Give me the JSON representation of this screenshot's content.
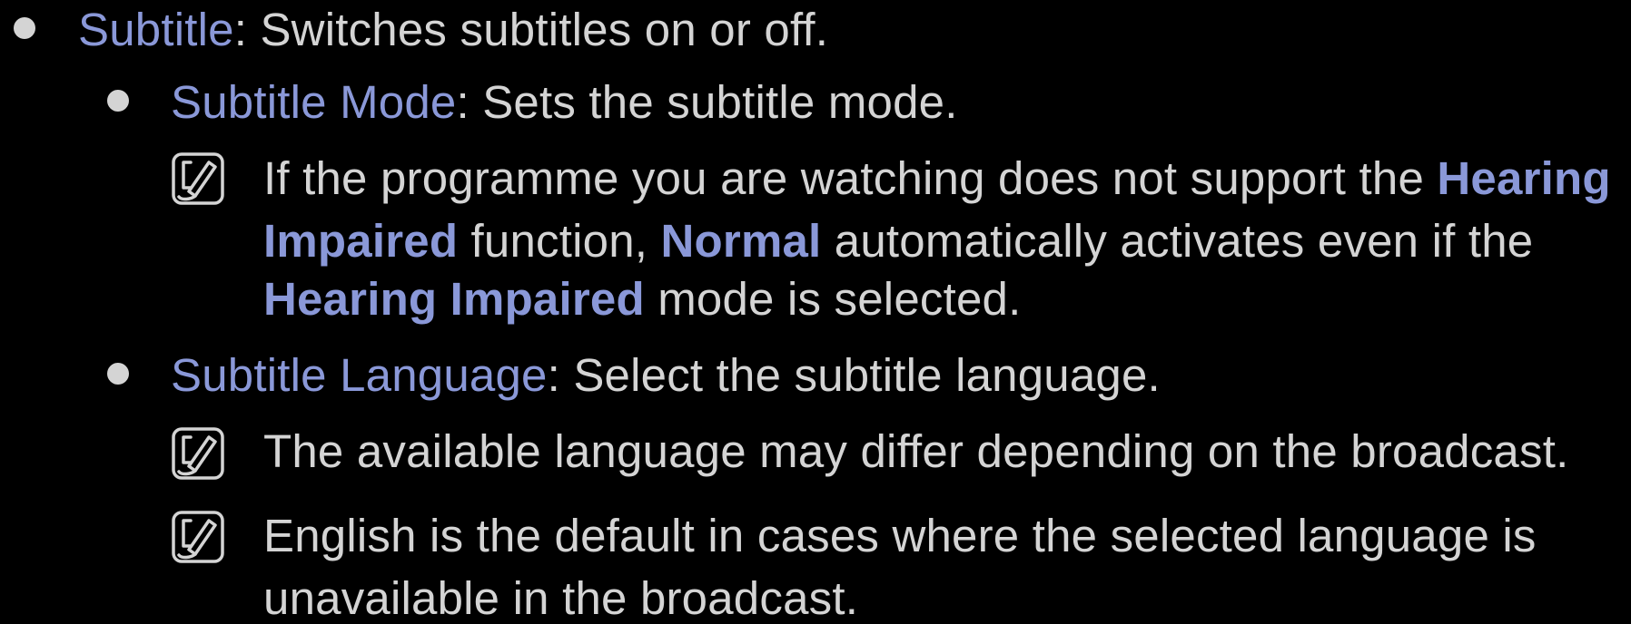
{
  "subtitle": {
    "term": "Subtitle",
    "desc": ": Switches subtitles on or off."
  },
  "subtitle_mode": {
    "term": "Subtitle Mode",
    "desc": ": Sets the subtitle mode.",
    "note": {
      "icon": "note-icon",
      "line1_text": "If the programme you are watching does not support the ",
      "line1_term": "Hearing",
      "line2_term": "Impaired",
      "line2_text_a": " function, ",
      "line2_term_b": "Normal",
      "line2_text_b": " automatically activates even if the",
      "line3_term": "Hearing Impaired",
      "line3_text": " mode is selected."
    }
  },
  "subtitle_language": {
    "term": "Subtitle Language",
    "desc": ": Select the subtitle language.",
    "note1": {
      "icon": "note-icon",
      "text": "The available language may differ depending on the broadcast."
    },
    "note2": {
      "icon": "note-icon",
      "line1": "English is the default in cases where the selected language is",
      "line2": "unavailable in the broadcast."
    }
  },
  "colors": {
    "background": "#000000",
    "text": "#d4d4d4",
    "highlight": "#8a98d8"
  }
}
